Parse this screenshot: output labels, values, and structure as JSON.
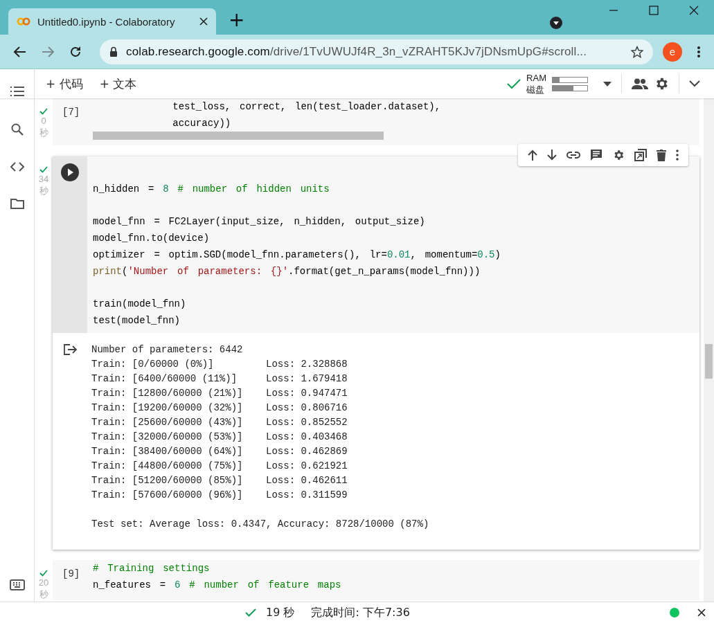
{
  "browser": {
    "tab_title": "Untitled0.ipynb - Colaboratory",
    "new_tab": "+",
    "url_host": "colab.research.google.com",
    "url_path": "/drive/1TvUWUJf4R_3n_vZRAHT5KJv7jDNsmUpG#scroll...",
    "profile": "e"
  },
  "toolbar": {
    "add_code": "+ 代码",
    "add_text": "+ 文本",
    "ram_label": "RAM",
    "disk_label": "磁盘",
    "ram": {
      "level": 0.2
    },
    "disk": {
      "level": 0.6
    }
  },
  "cells": [
    {
      "prompt": "[7]",
      "time": "0",
      "unit": "秒",
      "focused": false,
      "code_blocks": [
        [
          [
            {
              "kind": "plain",
              "text": "                  test_loss,  correct,  len(test_loader.dataset),"
            }
          ],
          [
            {
              "kind": "plain",
              "text": "                  accuracy))"
            }
          ]
        ]
      ]
    },
    {
      "time": "34",
      "unit": "秒",
      "focused": true,
      "code_blocks": [
        [
          [
            {
              "kind": "plain",
              "text": "n_hidden  =  "
            },
            {
              "kind": "number",
              "text": "8"
            },
            {
              "kind": "comment",
              "text": "  #  number  of  hidden  units"
            }
          ]
        ],
        [
          [
            {
              "kind": "plain",
              "text": "model_fnn  =  FC2Layer(input_size,  n_hidden,  output_size)"
            }
          ],
          [
            {
              "kind": "plain",
              "text": "model_fnn.to(device)"
            }
          ],
          [
            {
              "kind": "plain",
              "text": "optimizer  =  optim.SGD(model_fnn.parameters(),  lr="
            },
            {
              "kind": "number",
              "text": "0.01"
            },
            {
              "kind": "plain",
              "text": ",  momentum="
            },
            {
              "kind": "number",
              "text": "0.5"
            },
            {
              "kind": "plain",
              "text": ")"
            }
          ],
          [
            {
              "kind": "builtin",
              "text": "print"
            },
            {
              "kind": "plain",
              "text": "("
            },
            {
              "kind": "string",
              "text": "'Number  of  parameters:  {}'"
            },
            {
              "kind": "plain",
              "text": ".format(get_n_params(model_fnn)))"
            }
          ]
        ],
        [
          [
            {
              "kind": "plain",
              "text": "train(model_fnn)"
            }
          ],
          [
            {
              "kind": "plain",
              "text": "test(model_fnn)"
            }
          ]
        ]
      ],
      "output_blocks": [
        [
          "Number of parameters: 6442",
          "Train: [0/60000 (0%)]\tLoss: 2.328868",
          "Train: [6400/60000 (11%)]\tLoss: 1.679418",
          "Train: [12800/60000 (21%)]\tLoss: 0.947471",
          "Train: [19200/60000 (32%)]\tLoss: 0.806716",
          "Train: [25600/60000 (43%)]\tLoss: 0.852552",
          "Train: [32000/60000 (53%)]\tLoss: 0.403468",
          "Train: [38400/60000 (64%)]\tLoss: 0.462869",
          "Train: [44800/60000 (75%)]\tLoss: 0.621921",
          "Train: [51200/60000 (85%)]\tLoss: 0.462611",
          "Train: [57600/60000 (96%)]\tLoss: 0.311599"
        ],
        [
          "Test set: Average loss: 0.4347, Accuracy: 8728/10000 (87%)"
        ]
      ]
    },
    {
      "prompt": "[9]",
      "time": "20",
      "unit": "秒",
      "focused": false,
      "code_blocks": [
        [
          [
            {
              "kind": "comment",
              "text": "#  Training  settings"
            }
          ],
          [
            {
              "kind": "plain",
              "text": "n_features  =  "
            },
            {
              "kind": "number",
              "text": "6"
            },
            {
              "kind": "comment",
              "text": "  #  number  of  feature  maps"
            }
          ]
        ]
      ]
    }
  ],
  "status_bar": {
    "duration": "19 秒",
    "finished": "完成时间: 下午7:36"
  }
}
